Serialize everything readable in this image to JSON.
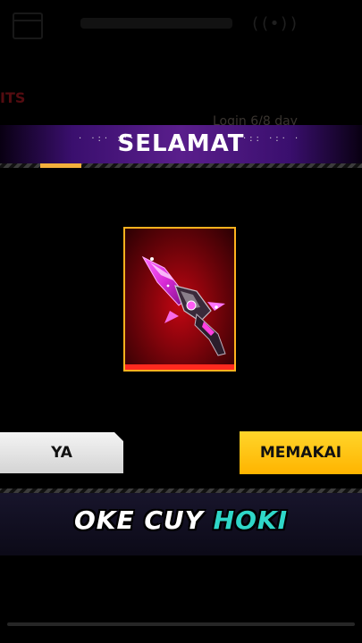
{
  "background": {
    "top_label": "",
    "red_label": "ITS",
    "login_text": "Login 6/8 day"
  },
  "dialog": {
    "title": "SELAMAT",
    "decor_left": "· ·:· ::·",
    "decor_right": "·:: ·:· ·",
    "item": {
      "name": "",
      "icon": "weapon-skin-icon",
      "frame_color": "#ffb21e",
      "glow_color": "#d00614"
    },
    "buttons": {
      "left_label": "YA",
      "right_label": "MEMAKAI"
    }
  },
  "caption": {
    "white": "OKE CUY",
    "cyan": "HOKI"
  },
  "colors": {
    "banner": "#5a1e8c",
    "accent_yellow": "#ffc21a",
    "caption_cyan": "#2fd7c8"
  }
}
